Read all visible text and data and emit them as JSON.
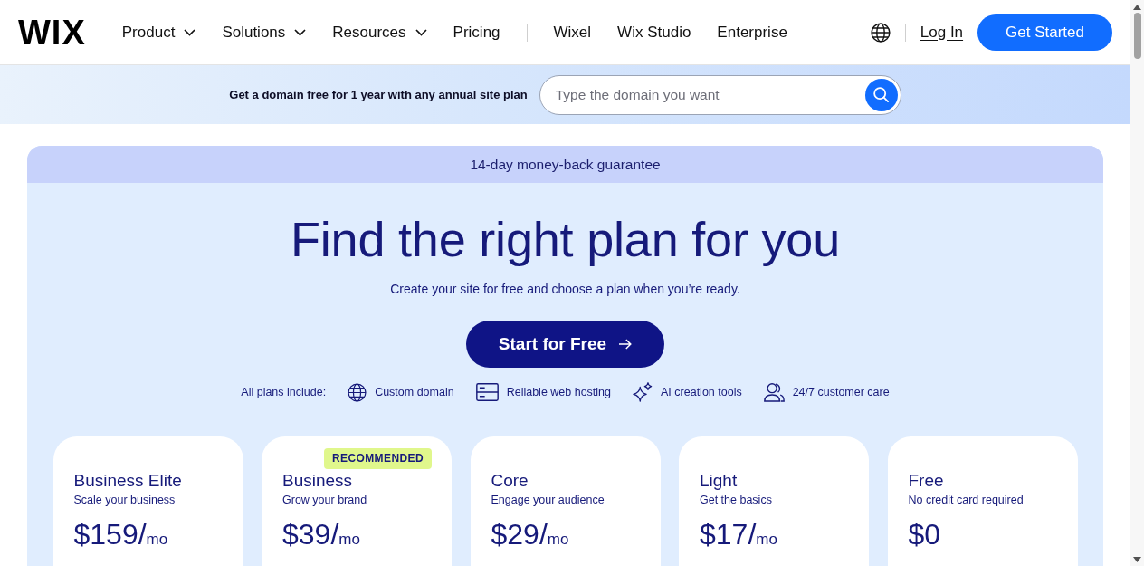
{
  "header": {
    "logo": "WIX",
    "nav": [
      {
        "label": "Product",
        "dropdown": true
      },
      {
        "label": "Solutions",
        "dropdown": true
      },
      {
        "label": "Resources",
        "dropdown": true
      },
      {
        "label": "Pricing",
        "dropdown": false
      }
    ],
    "products": [
      "Wixel",
      "Wix Studio",
      "Enterprise"
    ],
    "login": "Log In",
    "cta": "Get Started"
  },
  "domain_bar": {
    "text": "Get a domain free for 1 year with any annual site plan",
    "search": {
      "placeholder": "Type the domain you want"
    }
  },
  "pricing": {
    "guarantee": "14-day money-back guarantee",
    "title": "Find the right plan for you",
    "subtitle": "Create your site for free and choose a plan when you’re ready.",
    "cta": "Start for Free",
    "includes_label": "All plans include:",
    "includes": [
      {
        "kind": "globe",
        "label": "Custom domain"
      },
      {
        "kind": "server",
        "label": "Reliable web hosting"
      },
      {
        "kind": "sparkle",
        "label": "AI creation tools"
      },
      {
        "kind": "people",
        "label": "24/7 customer care"
      }
    ],
    "plans": [
      {
        "name": "Business Elite",
        "tagline": "Scale your business",
        "price": "$159/",
        "unit": "mo"
      },
      {
        "name": "Business",
        "tagline": "Grow your brand",
        "badge": "RECOMMENDED",
        "price": "$39/",
        "unit": "mo"
      },
      {
        "name": "Core",
        "tagline": "Engage your audience",
        "price": "$29/",
        "unit": "mo"
      },
      {
        "name": "Light",
        "tagline": "Get the basics",
        "price": "$17/",
        "unit": "mo"
      },
      {
        "name": "Free",
        "tagline": "No credit card required",
        "price": "$0"
      }
    ]
  }
}
